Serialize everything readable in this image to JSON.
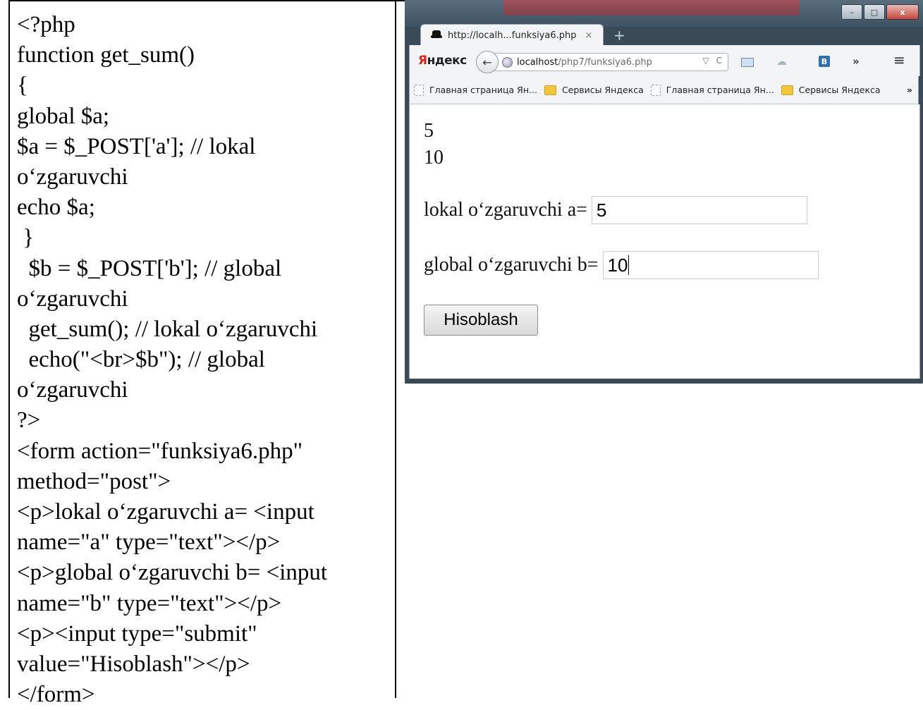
{
  "code": {
    "lines": [
      "<?php",
      "function get_sum()",
      "{",
      "global $a;",
      "$a = $_POST['a']; // lokal",
      "o‘zgaruvchi",
      "echo $a;",
      " }",
      "  $b = $_POST['b']; // global",
      "o‘zgaruvchi",
      "  get_sum(); // lokal o‘zgaruvchi",
      "  echo(\"<br>$b\"); // global",
      "o‘zgaruvchi",
      "?>",
      "<form action=\"funksiya6.php\"",
      "method=\"post\">",
      "<p>lokal o‘zgaruvchi a= <input",
      "name=\"a\" type=\"text\"></p>",
      "<p>global o‘zgaruvchi b= <input",
      "name=\"b\" type=\"text\"></p>",
      "<p><input type=\"submit\"",
      "value=\"Hisoblash\"></p>",
      "</form>"
    ]
  },
  "browser": {
    "tab_title": "http://localh...funksiya6.php",
    "tab_close": "×",
    "new_tab": "+",
    "window_controls": [
      "–",
      "□",
      "x"
    ],
    "yandex_logo_y": "Я",
    "yandex_logo_rest": "ндекс",
    "back_symbol": "←",
    "url_host": "localhost",
    "url_path": "/php7/funksiya6.php",
    "url_dropdown": "▽",
    "reload_symbol": "C",
    "addon_letter": "B",
    "more_symbol": "»",
    "menu_symbol": "≡",
    "bookmarks": [
      {
        "label": "Главная страница Ян...",
        "icon": "page-icon"
      },
      {
        "label": "Сервисы Яндекса",
        "icon": "folder-icon"
      },
      {
        "label": "Главная страница Ян...",
        "icon": "page-icon"
      },
      {
        "label": "Сервисы Яндекса",
        "icon": "folder-icon"
      }
    ],
    "bookmarks_overflow": "»",
    "page": {
      "output_a": "5",
      "output_b": "10",
      "label_a": "lokal o‘zgaruvchi a=",
      "value_a": "5",
      "label_b": "global o‘zgaruvchi b=",
      "value_b": "10",
      "submit_label": "Hisoblash"
    }
  }
}
